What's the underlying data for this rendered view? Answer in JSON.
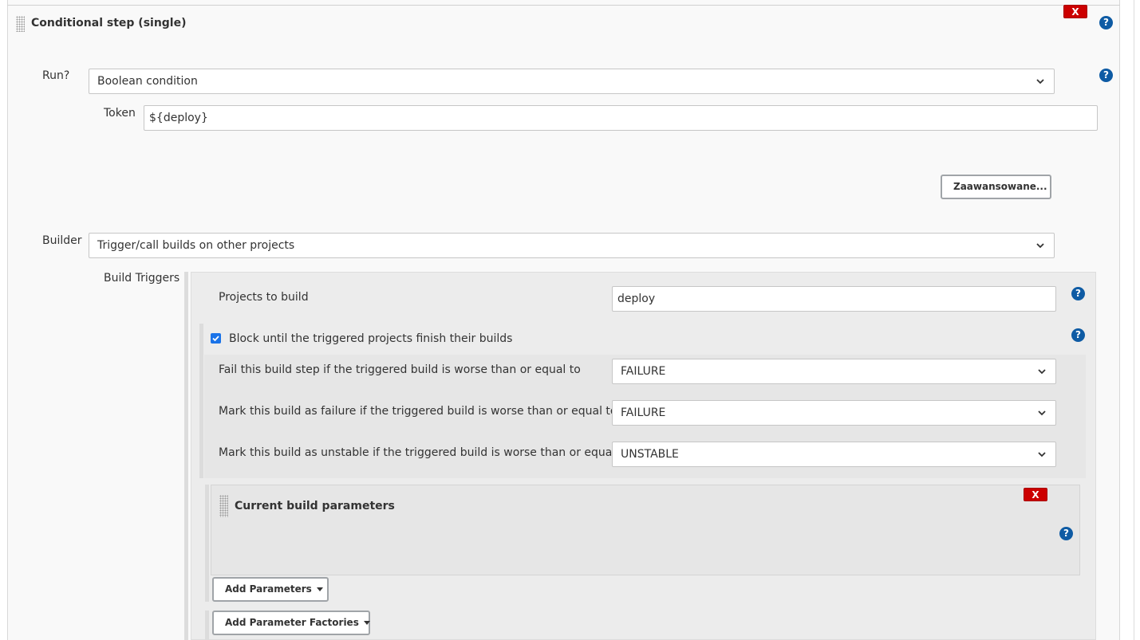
{
  "conditional_step": {
    "title": "Conditional step (single)",
    "delete_label": "X",
    "run_label": "Run?",
    "run_value": "Boolean condition",
    "token_label": "Token",
    "token_value": "${deploy}",
    "advanced_label": "Zaawansowane...",
    "builder_label": "Builder",
    "builder_value": "Trigger/call builds on other projects"
  },
  "build_triggers": {
    "label": "Build Triggers",
    "projects_label": "Projects to build",
    "projects_value": "deploy",
    "block_label": "Block until the triggered projects finish their builds",
    "block_checked": true,
    "fail_label": "Fail this build step if the triggered build is worse than or equal to",
    "fail_value": "FAILURE",
    "failure_label": "Mark this build as failure if the triggered build is worse than or equal to",
    "failure_value": "FAILURE",
    "unstable_label": "Mark this build as unstable if the triggered build is worse than or equal to",
    "unstable_value": "UNSTABLE"
  },
  "current_params": {
    "title": "Current build parameters",
    "delete_label": "X"
  },
  "buttons": {
    "add_parameters": "Add Parameters",
    "add_parameter_factories": "Add Parameter Factories"
  },
  "help_glyph": "?",
  "colors": {
    "delete_red": "#cc0000",
    "help_blue": "#0e5ba4",
    "checkbox_blue": "#1a73e8"
  }
}
